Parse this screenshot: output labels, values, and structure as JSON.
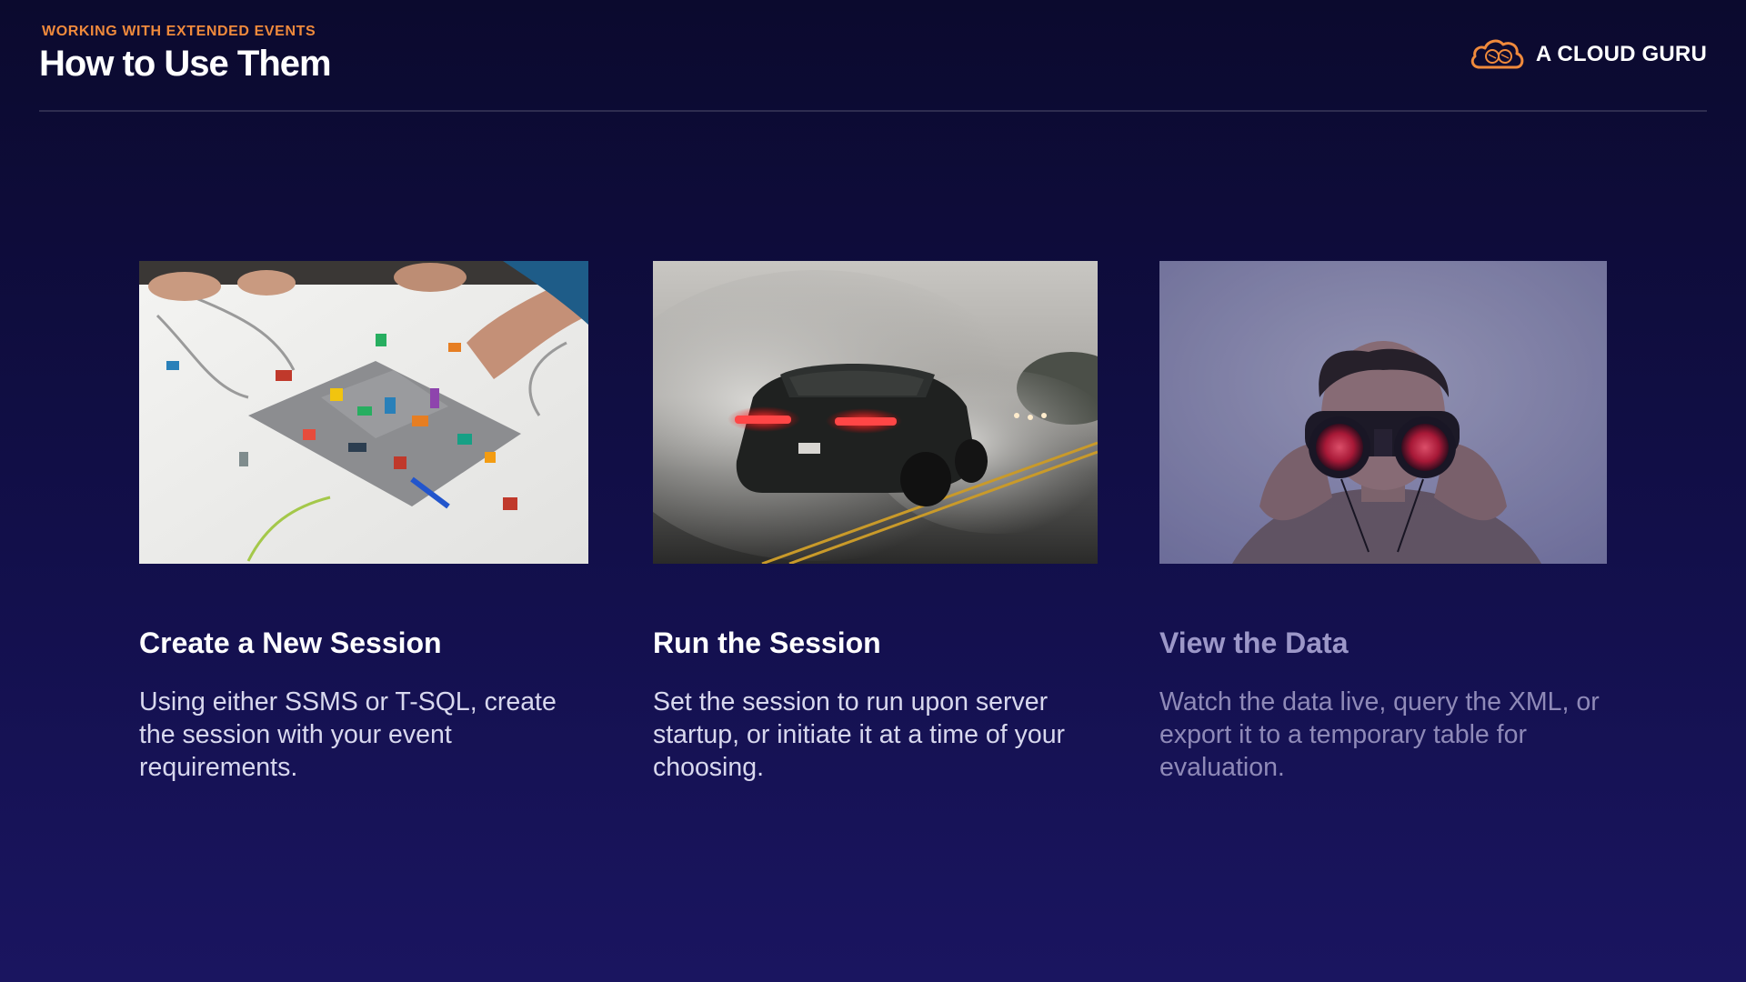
{
  "header": {
    "eyebrow": "WORKING WITH EXTENDED EVENTS",
    "title": "How to Use Them",
    "brand": "A CLOUD GURU",
    "brand_icon": "cloud-icon"
  },
  "colors": {
    "accent_orange": "#f08a3c",
    "background_top": "#0b0a2e",
    "background_bottom": "#1a1560"
  },
  "cards": [
    {
      "title": "Create a New Session",
      "text": "Using either SSMS or T-SQL, create the session with your event requirements.",
      "image": "lego-city-planning-photo",
      "dimmed": false
    },
    {
      "title": "Run the Session",
      "text": "Set the session to run upon server startup, or initiate it at a time of your choosing.",
      "image": "car-burnout-smoke-photo",
      "dimmed": false
    },
    {
      "title": "View the Data",
      "text": "Watch the data live, query the XML, or export it to a temporary table for evaluation.",
      "image": "person-with-binoculars-photo",
      "dimmed": true
    }
  ]
}
